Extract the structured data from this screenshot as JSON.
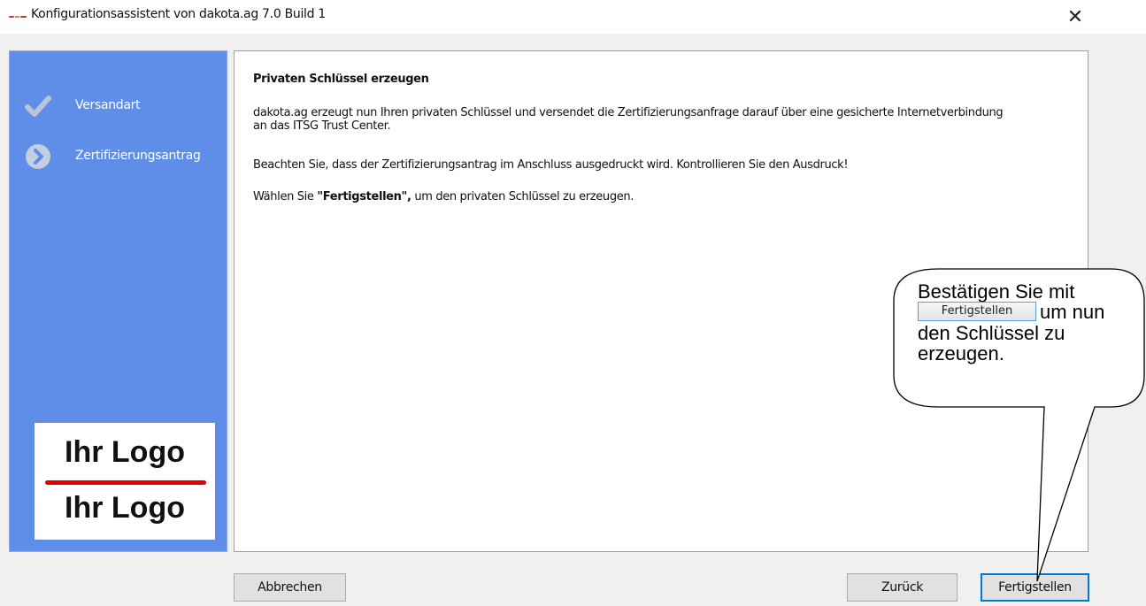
{
  "window": {
    "title": "Konfigurationsassistent von dakota.ag 7.0 Build 1",
    "close_glyph": "✕"
  },
  "sidebar": {
    "background": "#5e8ee8",
    "steps": [
      {
        "label": "Versandart",
        "icon": "checkmark-icon",
        "state": "completed"
      },
      {
        "label": "Zertifizierungsantrag",
        "icon": "arrow-right-circle-icon",
        "state": "current"
      }
    ],
    "logo": {
      "top": "Ihr Logo",
      "bottom": "Ihr Logo",
      "line_color": "#e00000"
    }
  },
  "content": {
    "heading": "Privaten Schlüssel erzeugen",
    "para1_line1": "dakota.ag erzeugt nun Ihren privaten Schlüssel und versendet die Zertifizierungsanfrage darauf über eine gesicherte Internetverbindung",
    "para1_line2": "an das ITSG Trust Center.",
    "para2": "Beachten Sie, dass der Zertifizierungsantrag im Anschluss ausgedruckt wird. Kontrollieren Sie den Ausdruck!",
    "para3_prefix": "Wählen Sie ",
    "para3_bold": "\"Fertigstellen\",",
    "para3_suffix": " um den privaten Schlüssel zu erzeugen."
  },
  "buttons": {
    "cancel": "Abbrechen",
    "back": "Zurück",
    "finish": "Fertigstellen"
  },
  "callout": {
    "line1": "Bestätigen Sie mit",
    "inline_button": "Fertigstellen",
    "line2_suffix": "um nun",
    "line3": "den Schlüssel zu",
    "line4": "erzeugen."
  },
  "colors": {
    "accent": "#0078d7",
    "sidebar": "#5e8ee8"
  }
}
